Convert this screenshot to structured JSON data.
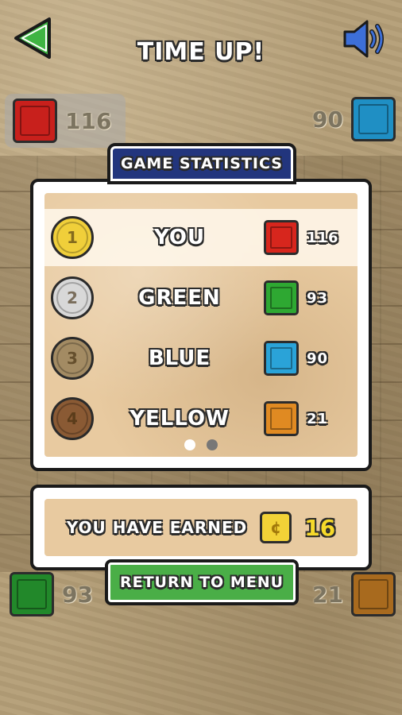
{
  "header": {
    "title": "TIME UP!",
    "back_icon": "back-arrow-icon",
    "sound_icon": "speaker-icon"
  },
  "corners": {
    "top_left": {
      "score": "116",
      "gem_color": "#c8201c"
    },
    "top_right": {
      "score": "90",
      "gem_color": "#1f8fc4"
    },
    "bottom_left": {
      "score": "93",
      "gem_color": "#22882a"
    },
    "bottom_right": {
      "score": "21",
      "gem_color": "#a86a1e"
    }
  },
  "stats": {
    "title": "GAME STATISTICS",
    "players": [
      {
        "rank": "1",
        "name": "YOU",
        "score": "116",
        "gem_color": "#d7261d",
        "medal_color": "#f0cf3a"
      },
      {
        "rank": "2",
        "name": "GREEN",
        "score": "93",
        "gem_color": "#2ea832",
        "medal_color": "#d8d8d8"
      },
      {
        "rank": "3",
        "name": "BLUE",
        "score": "90",
        "gem_color": "#2aa3d8",
        "medal_color": "#a38b63"
      },
      {
        "rank": "4",
        "name": "YELLOW",
        "score": "21",
        "gem_color": "#e08a22",
        "medal_color": "#8a5a34"
      }
    ],
    "page_dots": {
      "active_color": "#ffffff",
      "inactive_color": "#777777"
    }
  },
  "earned": {
    "label": "YOU HAVE EARNED",
    "coin_symbol": "¢",
    "value": "16"
  },
  "return_button": {
    "label": "RETURN TO MENU",
    "color": "#4aae47"
  }
}
